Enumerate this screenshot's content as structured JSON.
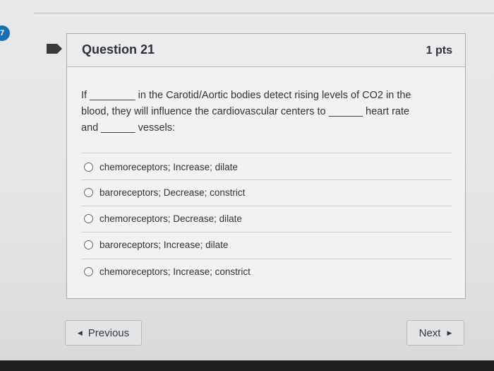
{
  "question": {
    "number_badge": "7",
    "title": "Question 21",
    "points": "1 pts",
    "text_lines": [
      "If ________ in the Carotid/Aortic bodies detect rising levels of CO2 in the",
      "blood, they will influence the cardiovascular centers to ______ heart rate",
      "and ______ vessels:"
    ],
    "options": [
      "chemoreceptors; Increase; dilate",
      "baroreceptors; Decrease; constrict",
      "chemoreceptors; Decrease; dilate",
      "baroreceptors; Increase; dilate",
      "chemoreceptors; Increase; constrict"
    ]
  },
  "nav": {
    "previous_label": "Previous",
    "next_label": "Next",
    "previous_icon": "triangle-left",
    "next_icon": "triangle-right"
  },
  "colors": {
    "badge": "#1a6fb0",
    "flag": "#3a3a3a"
  }
}
